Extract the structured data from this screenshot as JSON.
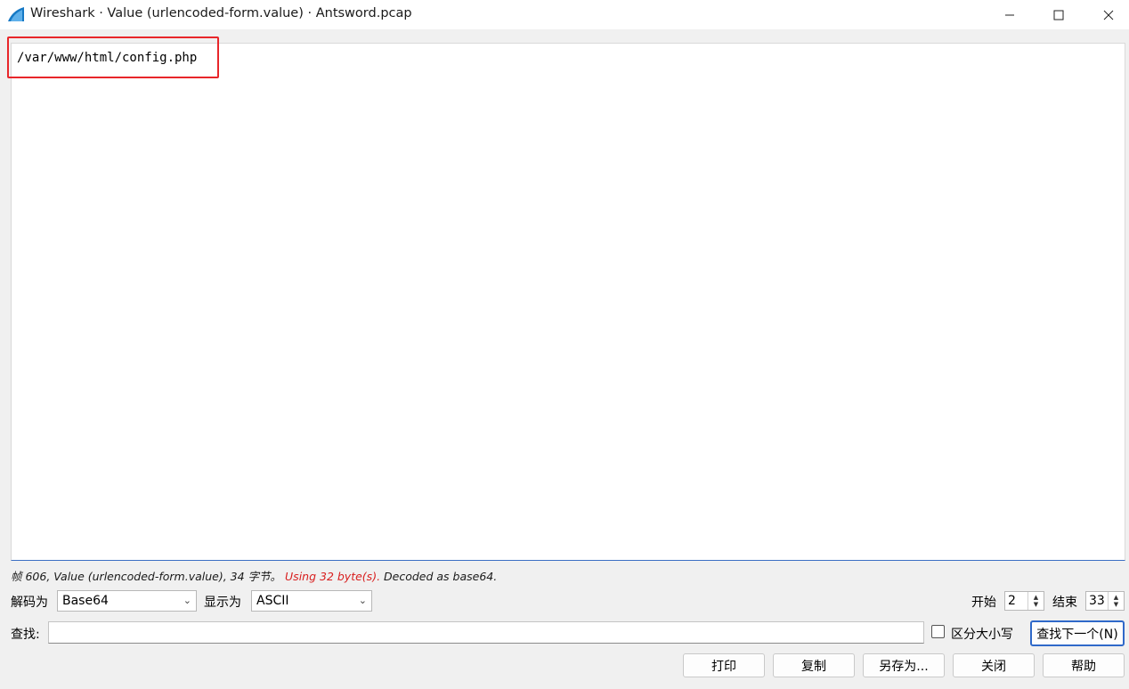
{
  "window": {
    "title": "Wireshark · Value (urlencoded-form.value) · Antsword.pcap",
    "app_icon": "wireshark-fin-icon",
    "controls": {
      "minimize": "—",
      "maximize": "☐",
      "close": "✕"
    }
  },
  "content": {
    "text": "/var/www/html/config.php",
    "highlight_color": "#e8262a"
  },
  "status": {
    "prefix": "帧 606, Value (urlencoded-form.value), 34 字节。",
    "warning": "Using 32 byte(s).",
    "suffix": "Decoded as base64."
  },
  "decode": {
    "decode_as_label": "解码为",
    "decode_as_value": "Base64",
    "show_as_label": "显示为",
    "show_as_value": "ASCII",
    "start_label": "开始",
    "start_value": "2",
    "end_label": "结束",
    "end_value": "33"
  },
  "find": {
    "label": "查找:",
    "value": "",
    "case_label": "区分大小写",
    "case_checked": false,
    "next_label": "查找下一个(N)"
  },
  "buttons": {
    "print": "打印",
    "copy": "复制",
    "save_as": "另存为...",
    "close": "关闭",
    "help": "帮助"
  },
  "colors": {
    "warning": "#d81e1e",
    "focus": "#2f69c9"
  }
}
